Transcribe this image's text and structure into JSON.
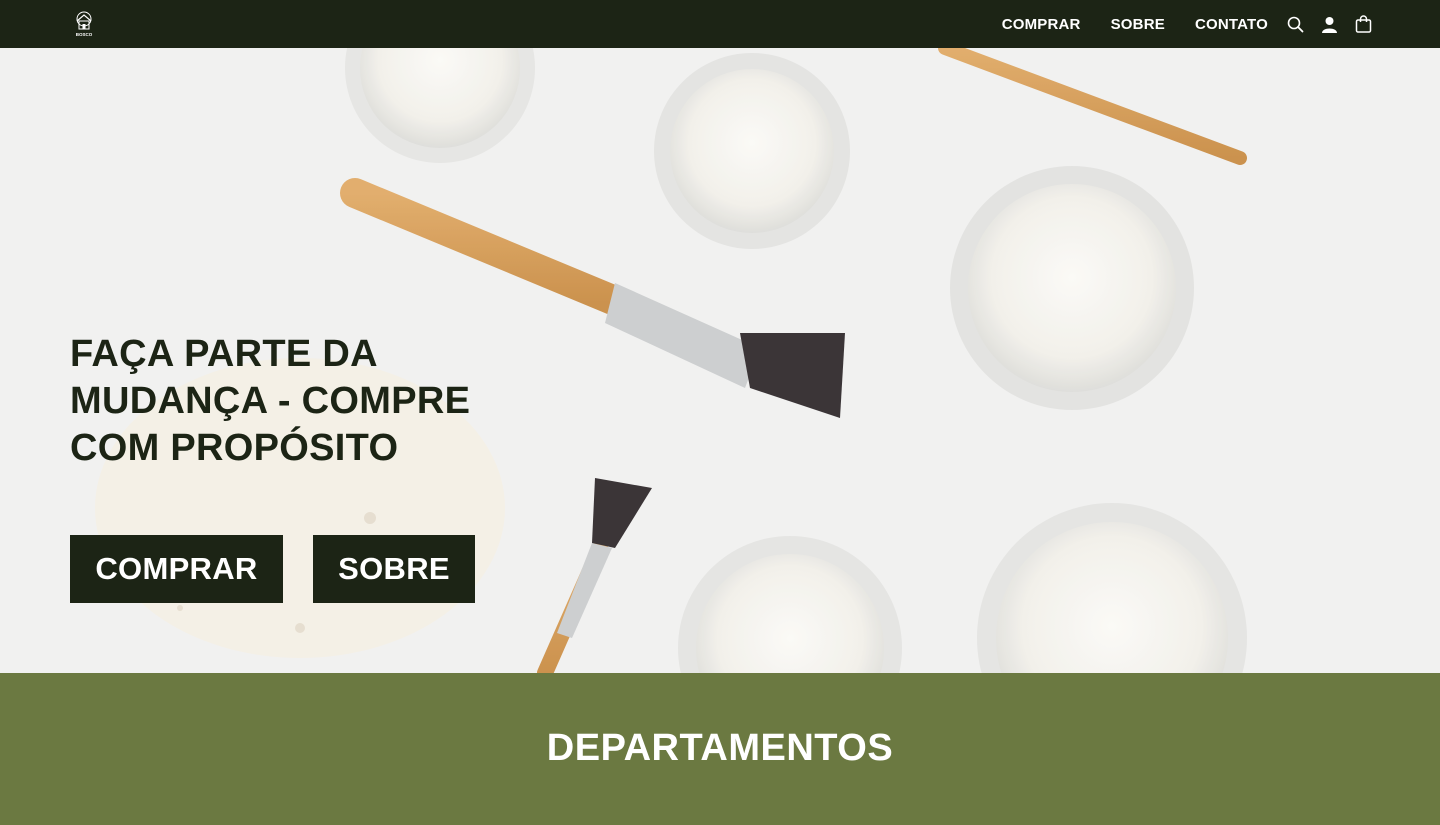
{
  "header": {
    "logo_text": "BOSCO",
    "nav": [
      {
        "label": "COMPRAR"
      },
      {
        "label": "SOBRE"
      },
      {
        "label": "CONTATO"
      }
    ],
    "icons": [
      "search-icon",
      "user-icon",
      "shopping-bag-icon"
    ]
  },
  "hero": {
    "title_line1": "FAÇA PARTE DA",
    "title_bold": "MUDANÇA",
    "title_rest": " - COMPRE",
    "title_line3": "COM PROPÓSITO",
    "buttons": {
      "comprar": "COMPRAR",
      "sobre": "SOBRE"
    }
  },
  "departments": {
    "title": "DEPARTAMENTOS"
  },
  "colors": {
    "header_bg": "#1c2415",
    "button_bg": "#1c2415",
    "section_bg": "#6b7941",
    "text_light": "#ffffff"
  }
}
